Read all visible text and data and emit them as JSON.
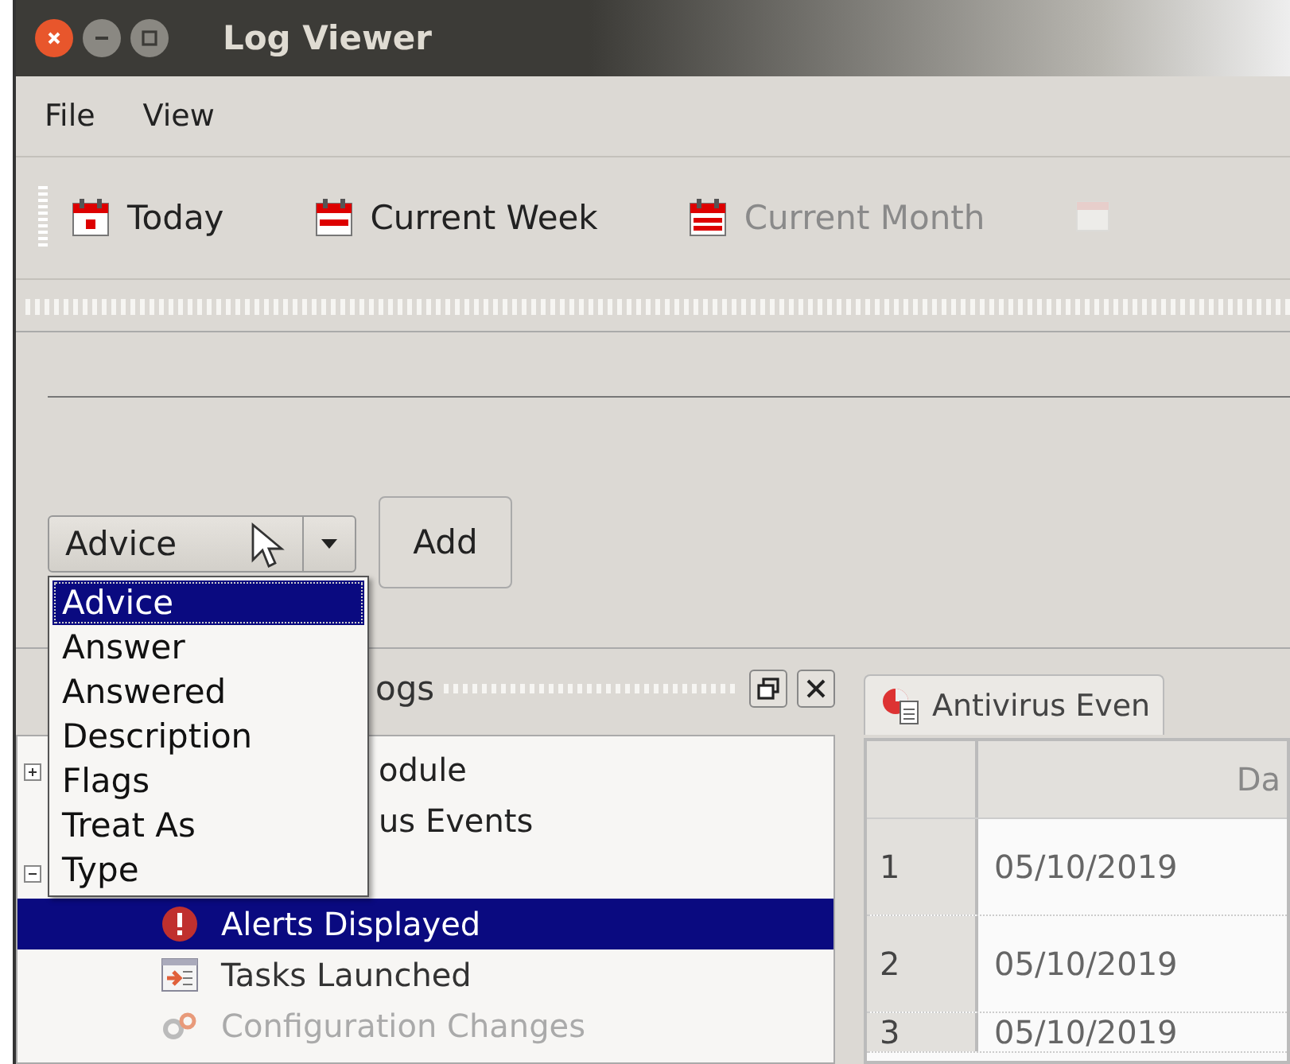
{
  "window": {
    "title": "Log Viewer"
  },
  "menu": [
    {
      "label": "File"
    },
    {
      "label": "View"
    }
  ],
  "toolbar": [
    {
      "label": "Today",
      "kind": "day",
      "disabled": false
    },
    {
      "label": "Current Week",
      "kind": "week",
      "disabled": false
    },
    {
      "label": "Current Month",
      "kind": "month",
      "disabled": true
    },
    {
      "kind": "other"
    }
  ],
  "filter": {
    "combo": {
      "value": "Advice",
      "options": [
        {
          "label": "Advice",
          "selected": true
        },
        {
          "label": "Answer",
          "selected": false
        },
        {
          "label": "Answered",
          "selected": false
        },
        {
          "label": "Description",
          "selected": false
        },
        {
          "label": "Flags",
          "selected": false
        },
        {
          "label": "Treat As",
          "selected": false
        },
        {
          "label": "Type",
          "selected": false
        }
      ]
    },
    "add_button": "Add"
  },
  "dock": {
    "title": "ogs",
    "tree": [
      {
        "label": "odule",
        "expanded": false
      },
      {
        "label": "us Events"
      },
      {
        "expanded": true,
        "children": [
          {
            "label": "Alerts Displayed",
            "kind": "alert",
            "selected": true,
            "disabled": false
          },
          {
            "label": "Tasks Launched",
            "kind": "task",
            "selected": false,
            "disabled": false
          },
          {
            "label": "Configuration Changes",
            "kind": "config",
            "selected": false,
            "disabled": true
          }
        ]
      }
    ]
  },
  "tabs": [
    {
      "label": "Antivirus Even",
      "selected": true
    }
  ],
  "table": {
    "columns": [
      "Da"
    ],
    "rows": [
      {
        "number": "1",
        "cells": [
          "05/10/2019"
        ]
      },
      {
        "number": "2",
        "cells": [
          "05/10/2019"
        ]
      },
      {
        "number": "3",
        "cells": [
          "05/10/2019"
        ]
      }
    ]
  }
}
